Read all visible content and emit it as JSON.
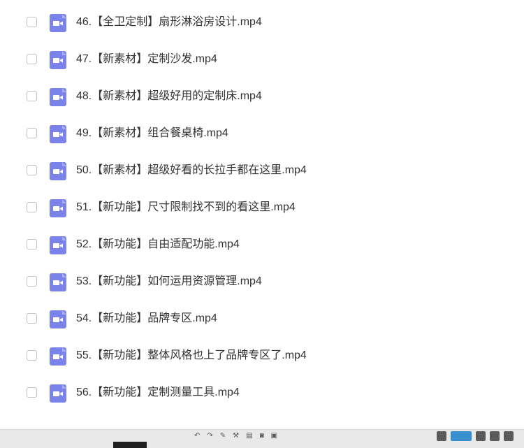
{
  "files": [
    {
      "name": "46.【全卫定制】扇形淋浴房设计.mp4",
      "icon": "video-file-icon"
    },
    {
      "name": "47.【新素材】定制沙发.mp4",
      "icon": "video-file-icon"
    },
    {
      "name": "48.【新素材】超级好用的定制床.mp4",
      "icon": "video-file-icon"
    },
    {
      "name": "49.【新素材】组合餐桌椅.mp4",
      "icon": "video-file-icon"
    },
    {
      "name": "50.【新素材】超级好看的长拉手都在这里.mp4",
      "icon": "video-file-icon"
    },
    {
      "name": "51.【新功能】尺寸限制找不到的看这里.mp4",
      "icon": "video-file-icon"
    },
    {
      "name": "52.【新功能】自由适配功能.mp4",
      "icon": "video-file-icon"
    },
    {
      "name": "53.【新功能】如何运用资源管理.mp4",
      "icon": "video-file-icon"
    },
    {
      "name": "54.【新功能】品牌专区.mp4",
      "icon": "video-file-icon"
    },
    {
      "name": "55.【新功能】整体风格也上了品牌专区了.mp4",
      "icon": "video-file-icon"
    },
    {
      "name": "56.【新功能】定制测量工具.mp4",
      "icon": "video-file-icon"
    }
  ],
  "colors": {
    "icon_bg": "#7b83eb",
    "text": "#333333",
    "checkbox_border": "#c2c2c2"
  }
}
